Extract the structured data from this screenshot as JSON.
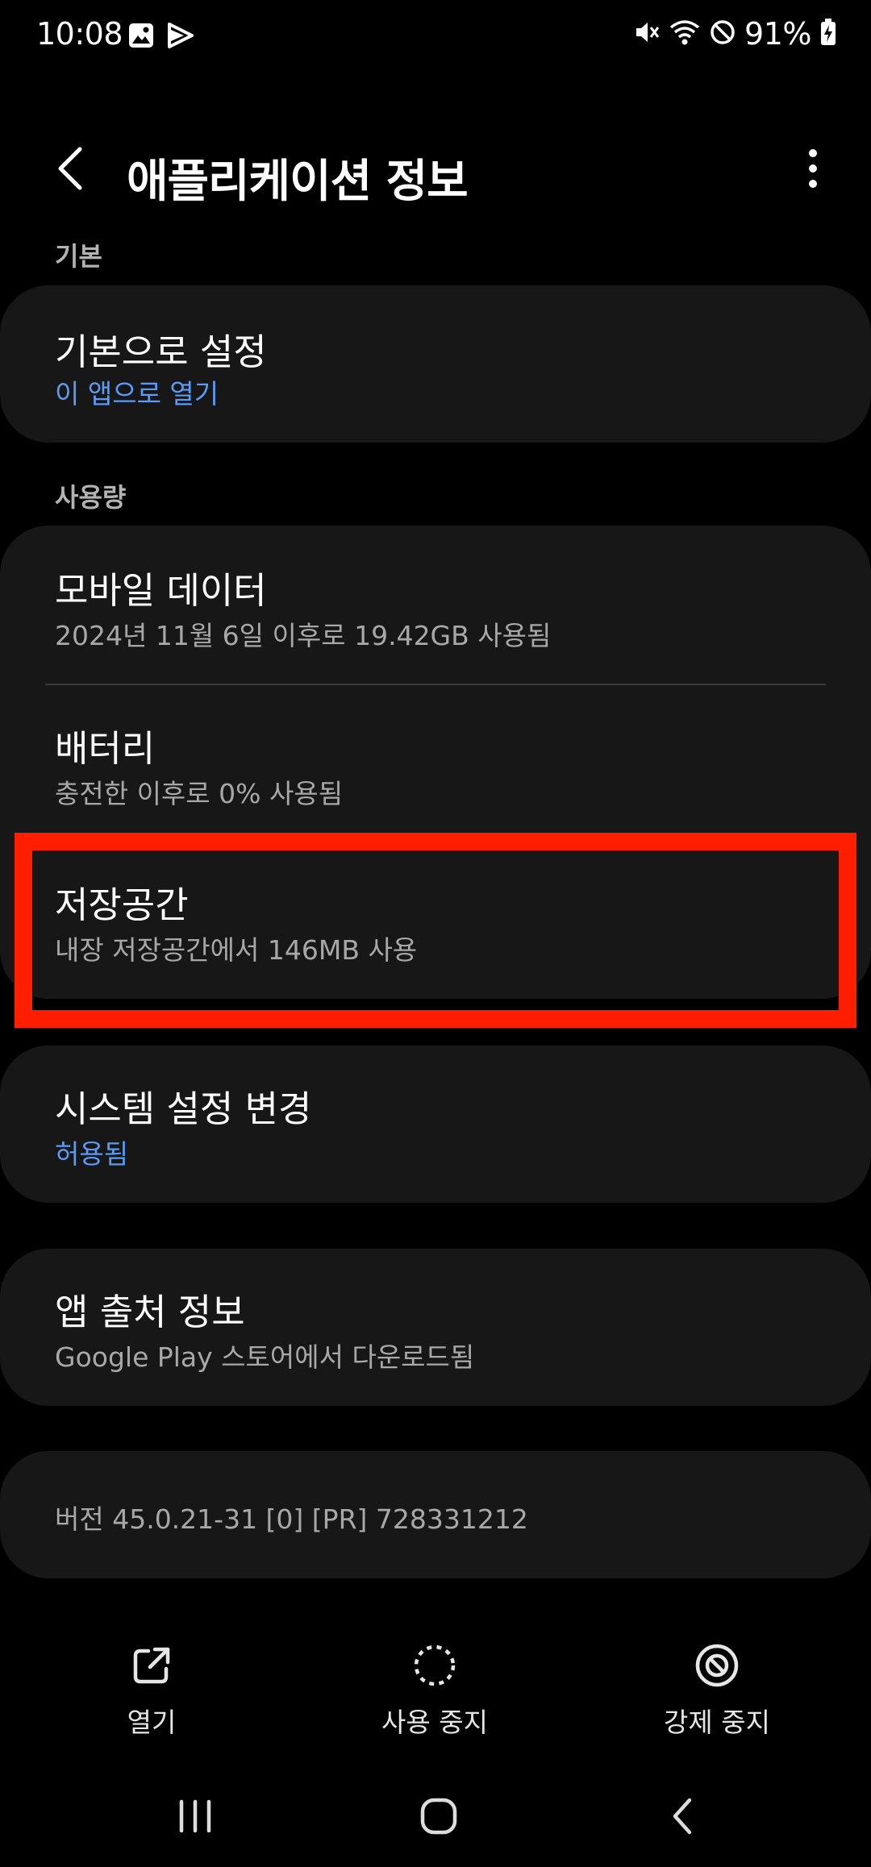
{
  "status_bar": {
    "time": "10:08",
    "battery": "91%",
    "icons": [
      "gallery-icon",
      "play-icon",
      "mute-icon",
      "wifi-icon",
      "do-not-disturb-icon",
      "battery-charging-icon"
    ]
  },
  "header": {
    "title": "애플리케이션 정보",
    "back_icon": "back-arrow-icon",
    "more_icon": "more-vertical-icon"
  },
  "sections": {
    "basic": {
      "label": "기본",
      "items": [
        {
          "title": "기본으로 설정",
          "subtitle": "이 앱으로 열기"
        }
      ]
    },
    "usage": {
      "label": "사용량",
      "items": [
        {
          "title": "모바일 데이터",
          "subtitle": "2024년 11월 6일 이후로 19.42GB 사용됨"
        },
        {
          "title": "배터리",
          "subtitle": "충전한 이후로 0% 사용됨"
        },
        {
          "title": "저장공간",
          "subtitle": "내장 저장공간에서 146MB 사용"
        }
      ]
    },
    "system": {
      "items": [
        {
          "title": "시스템 설정 변경",
          "subtitle": "허용됨"
        }
      ]
    },
    "source": {
      "items": [
        {
          "title": "앱 출처 정보",
          "subtitle": "Google Play 스토어에서 다운로드됨"
        }
      ]
    },
    "version": {
      "text": "버전 45.0.21-31 [0] [PR] 728331212"
    }
  },
  "actions": [
    {
      "label": "열기",
      "icon": "open-external-icon"
    },
    {
      "label": "사용 중지",
      "icon": "disable-dashed-circle-icon"
    },
    {
      "label": "강제 중지",
      "icon": "force-stop-icon"
    }
  ],
  "nav": {
    "recent_icon": "recent-apps-icon",
    "home_icon": "home-icon",
    "back_icon": "nav-back-icon"
  },
  "colors": {
    "background": "#000000",
    "card": "#171717",
    "accent_blue": "#5a9bf6",
    "highlight_red": "#ff1f00",
    "secondary_text": "#a8a8a8"
  }
}
